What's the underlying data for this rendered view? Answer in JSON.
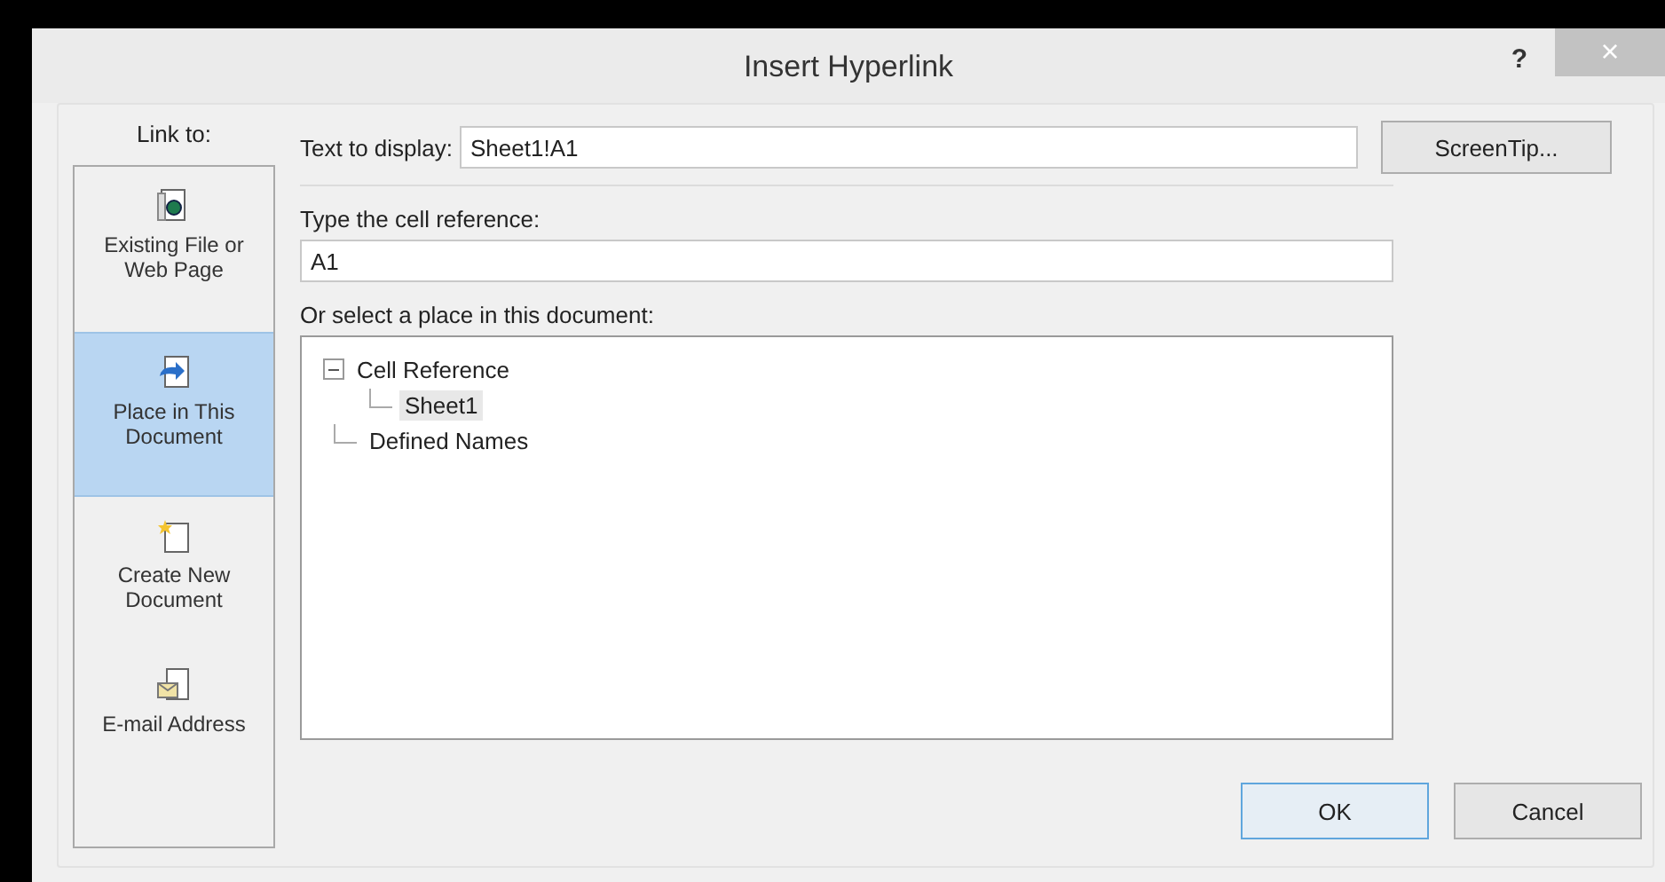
{
  "window": {
    "title": "Insert Hyperlink",
    "help": "?",
    "close": "×"
  },
  "link_to": {
    "label": "Link to:",
    "items": [
      {
        "kind": "file",
        "label": "Existing File or Web Page",
        "selected": false
      },
      {
        "kind": "place",
        "label": "Place in This Document",
        "selected": true
      },
      {
        "kind": "new",
        "label": "Create New Document",
        "selected": false
      },
      {
        "kind": "email",
        "label": "E-mail Address",
        "selected": false
      }
    ]
  },
  "text_to_display": {
    "label": "Text to display:",
    "value": "Sheet1!A1"
  },
  "screentip_button": "ScreenTip...",
  "cell_reference": {
    "label": "Type the cell reference:",
    "value": "A1"
  },
  "place_list": {
    "label": "Or select a place in this document:",
    "items": [
      {
        "label": "Cell Reference",
        "expanded": true,
        "selected": false,
        "children": [
          {
            "label": "Sheet1",
            "selected": true
          }
        ]
      },
      {
        "label": "Defined Names",
        "selected": false
      }
    ]
  },
  "buttons": [
    {
      "label": "OK",
      "default": true
    },
    {
      "label": "Cancel",
      "default": false
    }
  ]
}
